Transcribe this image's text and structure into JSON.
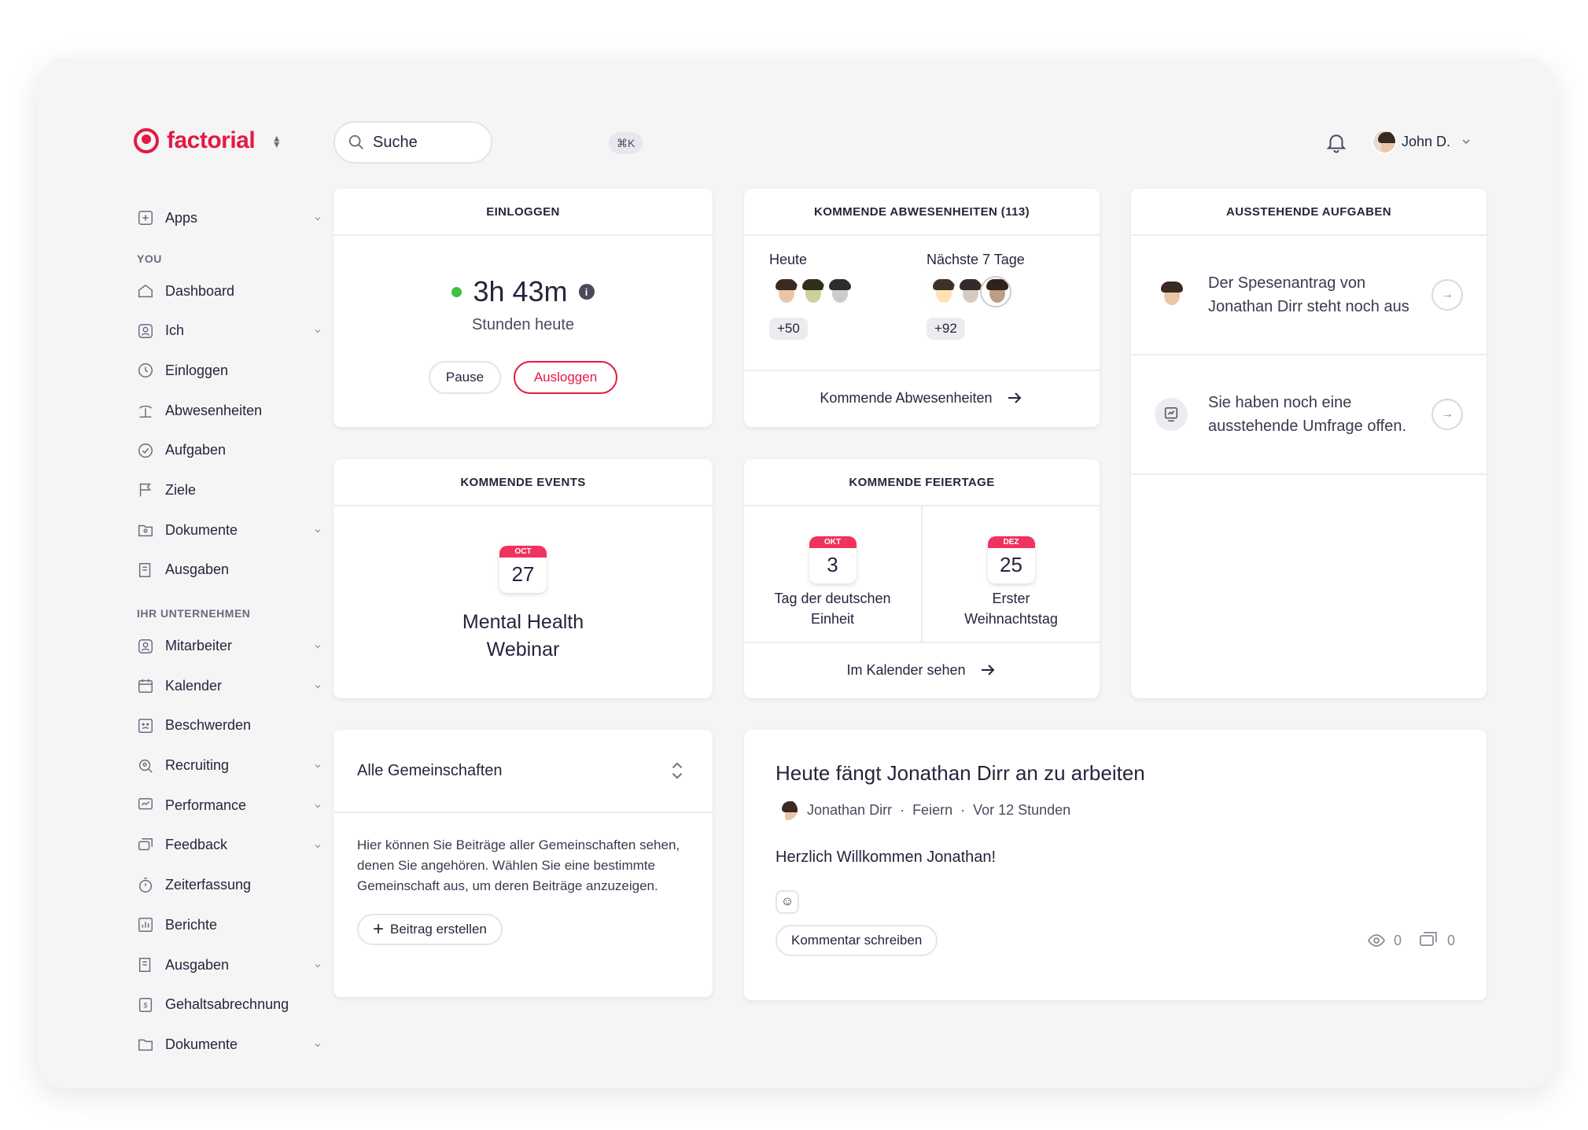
{
  "brand": {
    "name": "factorial"
  },
  "search": {
    "label": "Suche",
    "shortcut": "⌘K"
  },
  "user": {
    "name": "John D."
  },
  "sidebar": {
    "top": [
      {
        "label": "Apps",
        "icon": "apps-icon",
        "chev": true
      }
    ],
    "you_title": "YOU",
    "you": [
      {
        "label": "Dashboard",
        "icon": "home-icon",
        "chev": false
      },
      {
        "label": "Ich",
        "icon": "person-icon",
        "chev": true
      },
      {
        "label": "Einloggen",
        "icon": "clock-icon",
        "chev": false
      },
      {
        "label": "Abwesenheiten",
        "icon": "palm-icon",
        "chev": false
      },
      {
        "label": "Aufgaben",
        "icon": "check-circle-icon",
        "chev": false
      },
      {
        "label": "Ziele",
        "icon": "flag-icon",
        "chev": false
      },
      {
        "label": "Dokumente",
        "icon": "folder-person-icon",
        "chev": true
      },
      {
        "label": "Ausgaben",
        "icon": "receipt-icon",
        "chev": false
      }
    ],
    "company_title": "IHR UNTERNEHMEN",
    "company": [
      {
        "label": "Mitarbeiter",
        "icon": "employees-icon",
        "chev": true
      },
      {
        "label": "Kalender",
        "icon": "calendar-icon",
        "chev": true
      },
      {
        "label": "Beschwerden",
        "icon": "complaint-icon",
        "chev": false
      },
      {
        "label": "Recruiting",
        "icon": "recruiting-icon",
        "chev": true
      },
      {
        "label": "Performance",
        "icon": "performance-icon",
        "chev": true
      },
      {
        "label": "Feedback",
        "icon": "feedback-icon",
        "chev": true
      },
      {
        "label": "Zeiterfassung",
        "icon": "stopwatch-icon",
        "chev": false
      },
      {
        "label": "Berichte",
        "icon": "chart-icon",
        "chev": false
      },
      {
        "label": "Ausgaben",
        "icon": "receipt-icon",
        "chev": true
      },
      {
        "label": "Gehaltsabrechnung",
        "icon": "payroll-icon",
        "chev": false
      },
      {
        "label": "Dokumente",
        "icon": "folder-icon",
        "chev": true
      }
    ]
  },
  "clock": {
    "title": "EINLOGGEN",
    "time": "3h 43m",
    "sub": "Stunden heute",
    "pause": "Pause",
    "logout": "Ausloggen",
    "status_color": "#3ec13e"
  },
  "absences": {
    "title": "KOMMENDE ABWESENHEITEN (113)",
    "today_label": "Heute",
    "today_more": "+50",
    "week_label": "Nächste 7 Tage",
    "week_more": "+92",
    "link": "Kommende Abwesenheiten"
  },
  "tasks": {
    "title": "AUSSTEHENDE AUFGABEN",
    "items": [
      {
        "text": "Der Spesenantrag von Jonathan Dirr steht noch aus"
      },
      {
        "text": "Sie haben noch eine ausstehende Umfrage offen."
      }
    ]
  },
  "events": {
    "title": "KOMMENDE EVENTS",
    "month": "OCT",
    "day": "27",
    "name": "Mental Health Webinar"
  },
  "holidays": {
    "title": "KOMMENDE FEIERTAGE",
    "items": [
      {
        "month": "OKT",
        "day": "3",
        "name": "Tag der deutschen Einheit"
      },
      {
        "month": "DEZ",
        "day": "25",
        "name": "Erster Weihnachtstag"
      }
    ],
    "link": "Im Kalender sehen"
  },
  "communities": {
    "select": "Alle Gemeinschaften",
    "desc": "Hier können Sie Beiträge aller Gemeinschaften sehen, denen Sie angehören. Wählen Sie eine bestimmte Gemeinschaft aus, um deren Beiträge anzuzeigen.",
    "create": "Beitrag erstellen"
  },
  "post": {
    "title": "Heute fängt Jonathan Dirr an zu arbeiten",
    "author": "Jonathan Dirr",
    "category": "Feiern",
    "time": "Vor 12 Stunden",
    "sep": "·",
    "body": "Herzlich Willkommen Jonathan!",
    "comment": "Kommentar schreiben",
    "views": "0",
    "comments": "0"
  },
  "colors": {
    "accent": "#e51943",
    "calendar": "#f0325e"
  }
}
